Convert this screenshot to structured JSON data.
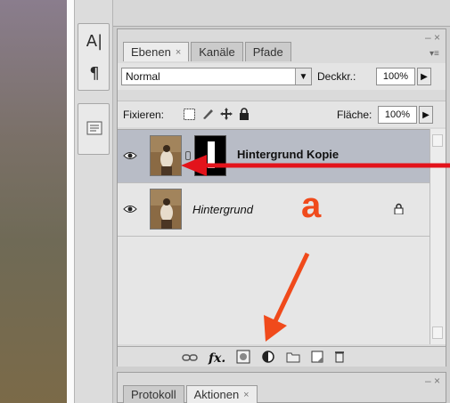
{
  "tools": {
    "text_tool_glyph": "A|",
    "paragraph_glyph": "¶",
    "icons": [
      "character-panel-icon",
      "paragraph-panel-icon",
      "notes-panel-icon"
    ]
  },
  "layers_panel": {
    "tabs": [
      {
        "label": "Ebenen",
        "active": true,
        "closable": true
      },
      {
        "label": "Kanäle",
        "active": false
      },
      {
        "label": "Pfade",
        "active": false
      }
    ],
    "close_glyph": "×",
    "blend_mode": "Normal",
    "opacity_label": "Deckkr.:",
    "opacity_value": "100%",
    "lock_label": "Fixieren:",
    "fill_label": "Fläche:",
    "fill_value": "100%",
    "layers": [
      {
        "name": "Hintergrund Kopie",
        "selected": true,
        "visible": true,
        "has_mask": true
      },
      {
        "name": "Hintergrund",
        "selected": false,
        "visible": true,
        "locked": true
      }
    ],
    "bottom_icons": [
      "link-layers-icon",
      "fx-icon",
      "add-mask-icon",
      "adjustment-layer-icon",
      "new-group-icon",
      "new-layer-icon",
      "trash-icon"
    ],
    "fx_label": "fx."
  },
  "history_panel": {
    "tabs": [
      {
        "label": "Protokoll",
        "active": false
      },
      {
        "label": "Aktionen",
        "active": true,
        "closable": true
      }
    ]
  },
  "annotations": {
    "letter": "a",
    "arrow_color": "#e3131b",
    "arrow2_color": "#f04a1b"
  }
}
